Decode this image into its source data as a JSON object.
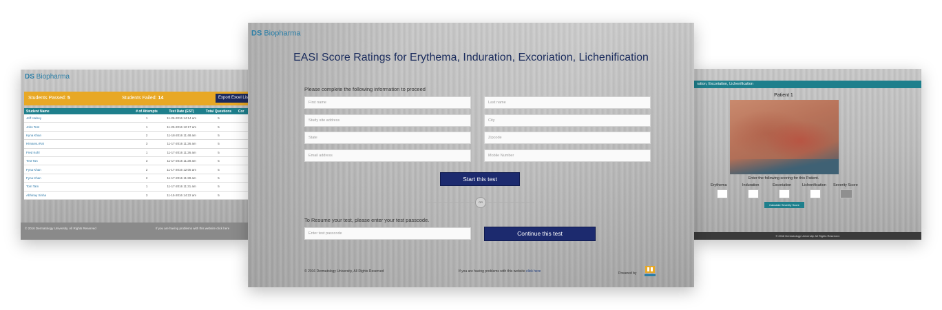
{
  "brand": {
    "bold": "DS",
    "rest": " Biopharma"
  },
  "left": {
    "students_passed_label": "Students Passed:",
    "students_passed_value": "5",
    "students_failed_label": "Students Failed:",
    "students_failed_value": "14",
    "export_label": "Export Excel Lis",
    "columns": [
      "Student Name",
      "# of Attempts",
      "Test Date (EST)",
      "Total Questions",
      "Cor"
    ],
    "rows": [
      [
        "Jeff Halsey",
        "1",
        "11-26-2016 14:14 am",
        "5"
      ],
      [
        "John Test",
        "1",
        "11-25-2016 12:17 am",
        "5"
      ],
      [
        "Kyna Khan",
        "2",
        "11-18-2016 11:48 am",
        "5"
      ],
      [
        "Himansu Rai",
        "3",
        "11-17-2016 11:26 am",
        "5"
      ],
      [
        "Fred Kohl",
        "1",
        "11-17-2016 11:26 am",
        "5"
      ],
      [
        "Test Tan",
        "3",
        "11-17-2016 11:28 am",
        "5"
      ],
      [
        "Fyna Khan",
        "2",
        "11-17-2016 12:05 am",
        "5"
      ],
      [
        "Fyna Khan",
        "2",
        "11-17-2016 11:28 am",
        "5"
      ],
      [
        "Tom Tam",
        "1",
        "11-17-2016 11:31 am",
        "5"
      ],
      [
        "Abhinay Sinha",
        "3",
        "11-15-2016 14:22 am",
        "5"
      ]
    ],
    "footer_left": "© 2016 Dermatology University. All Rights Reserved",
    "footer_right": "If you are having problems with this website click here"
  },
  "center": {
    "title": "EASI Score Ratings for Erythema, Induration, Excoriation, Lichenification",
    "prompt": "Please complete the following information to proceed",
    "placeholders": {
      "first_name": "First name",
      "last_name": "Last name",
      "study_site": "Study site address",
      "city": "City",
      "state": "State",
      "zipcode": "Zipcode",
      "email": "Email address",
      "mobile": "Mobile Number",
      "passcode": "Enter test passcode"
    },
    "start_button": "Start this test",
    "or_label": "OR",
    "resume_prompt": "To Resume your test, please enter your test passcode.",
    "continue_button": "Continue this test",
    "footer_left": "© 2016 Dermatology University, All Rights Reserved",
    "footer_mid_text": "If you are having problems with this website",
    "footer_mid_link": "click here",
    "powered_by": "Powered by"
  },
  "right": {
    "topbar": "ration, Excoriation, Lichenification",
    "patient_title": "Patient 1",
    "instruction": "Enter the following scoring for this Patient.",
    "score_labels": [
      "Erythema",
      "Induration",
      "Excoriation",
      "Lichenification",
      "Severity Score"
    ],
    "calc_button": "Calculate Severity Score",
    "footer": "© 2016 Dermatology University. All Rights Reserved."
  },
  "colors": {
    "brand_blue": "#2a7ea6",
    "navy": "#1c2a6e",
    "teal": "#1e7f8c",
    "gold": "#e8a825"
  }
}
